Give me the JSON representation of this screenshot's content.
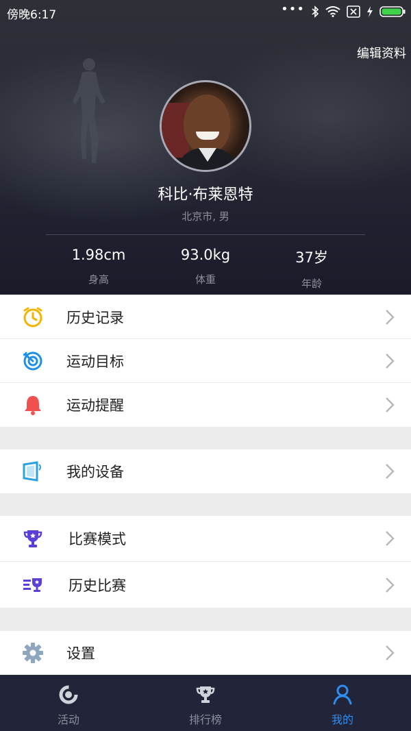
{
  "status_bar": {
    "time": "傍晚6:17"
  },
  "header": {
    "edit_label": "编辑资料",
    "name": "科比·布莱恩特",
    "location": "北京市, 男",
    "stats": [
      {
        "value": "1.98cm",
        "label": "身高"
      },
      {
        "value": "93.0kg",
        "label": "体重"
      },
      {
        "value": "37岁",
        "label": "年龄"
      }
    ]
  },
  "menu": {
    "history": "历史记录",
    "goal": "运动目标",
    "reminder": "运动提醒",
    "device": "我的设备",
    "match_mode": "比赛模式",
    "match_history": "历史比赛",
    "settings": "设置"
  },
  "bottom_nav": {
    "tabs": [
      {
        "label": "活动",
        "icon": "activity-icon"
      },
      {
        "label": "排行榜",
        "icon": "trophy-icon"
      },
      {
        "label": "我的",
        "icon": "person-icon"
      }
    ],
    "active_tab": "我的"
  },
  "colors": {
    "accent": "#2e8ef0",
    "nav_bg": "#22243a",
    "clock_icon": "#f5b400",
    "target_icon": "#1e90e6",
    "bell_icon": "#f05050",
    "device_icon": "#2aa0e6",
    "match_icon": "#5b3fd6",
    "gear_icon": "#8fa6bf"
  }
}
